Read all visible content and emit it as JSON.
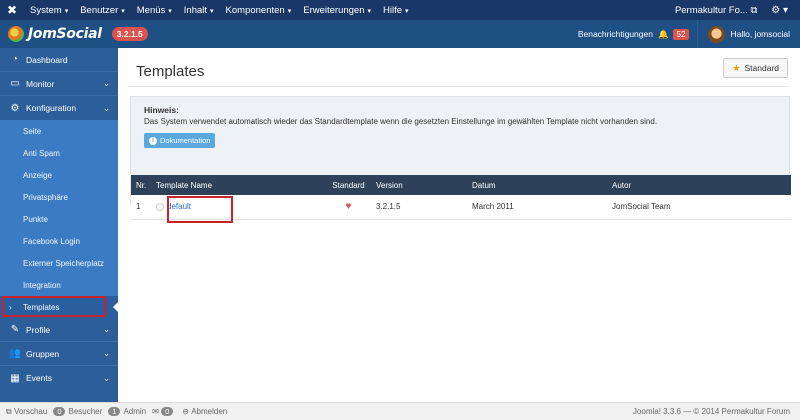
{
  "topbar": {
    "logo_icon": "joomla-icon",
    "menu": [
      "System",
      "Benutzer",
      "Menüs",
      "Inhalt",
      "Komponenten",
      "Erweiterungen",
      "Hilfe"
    ],
    "site_name": "Permakultur Fo...",
    "external_icon": "external-link-icon",
    "gear_icon": "gear-icon"
  },
  "header": {
    "brand": "JomSocial",
    "version": "3.2.1.5",
    "notifications_label": "Benachrichtigungen",
    "notifications_count": "52",
    "user_greeting": "Hallo, jomsocial"
  },
  "sidebar": {
    "items_top": [
      {
        "label": "Dashboard",
        "icon": "dashboard-icon"
      },
      {
        "label": "Monitor",
        "icon": "monitor-icon"
      },
      {
        "label": "Konfiguration",
        "icon": "cogs-icon"
      }
    ],
    "sub_items": [
      "Seite",
      "Anti Spam",
      "Anzeige",
      "Privatsphäre",
      "Punkte",
      "Facebook Login",
      "Externer Speicherplatz",
      "Integration",
      "Templates"
    ],
    "items_bottom": [
      {
        "label": "Profile",
        "icon": "edit-icon"
      },
      {
        "label": "Gruppen",
        "icon": "users-icon"
      },
      {
        "label": "Events",
        "icon": "calendar-icon"
      }
    ]
  },
  "main": {
    "title": "Templates",
    "standard_button": "Standard",
    "info": {
      "heading": "Hinweis:",
      "text": "Das System verwendet automatisch wieder das Standardtemplate wenn die gesetzten Einstellunge im gewählten Template nicht vorhanden sind.",
      "doc_button": "Dokumentation"
    },
    "table": {
      "headers": [
        "Nr.",
        "Template Name",
        "Standard",
        "Version",
        "Datum",
        "Autor"
      ],
      "rows": [
        {
          "nr": "1",
          "name": "default",
          "version": "3.2.1.5",
          "date": "March 2011",
          "author": "JomSocial Team"
        }
      ]
    }
  },
  "footer": {
    "preview": "Vorschau",
    "visitors_count": "0",
    "visitors_label": "Besucher",
    "admin_count": "1",
    "admin_label": "Admin",
    "messages_count": "0",
    "logout": "Abmelden",
    "copyright": "Joomla! 3.3.6 — © 2014 Permakultur Forum"
  }
}
